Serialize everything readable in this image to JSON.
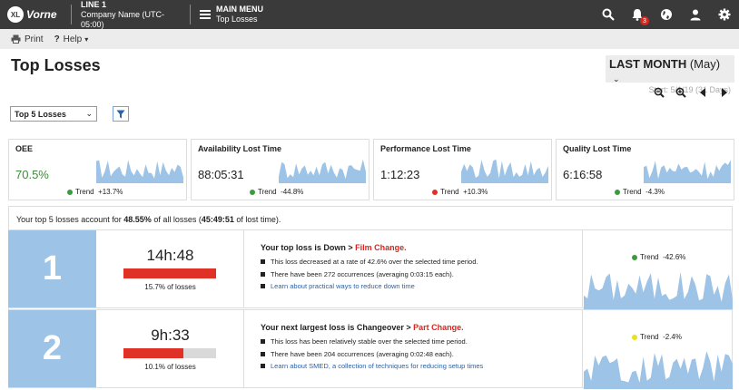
{
  "topbar": {
    "logo_text": "Vorne",
    "logo_mark": "XL",
    "line_title": "LINE 1",
    "company": "Company Name (UTC-05:00)",
    "menu_title": "MAIN MENU",
    "menu_sub": "Top Losses",
    "notification_count": "3",
    "icons": [
      "search-icon",
      "bell-icon",
      "globe-icon",
      "user-icon",
      "gear-icon"
    ]
  },
  "subbar": {
    "print_label": "Print",
    "help_label": "Help"
  },
  "page_title": "Top Losses",
  "period": {
    "label": "LAST MONTH",
    "month": "(May)",
    "start": "Start: 5/1/19 (31 Days)"
  },
  "selector": {
    "value": "Top 5 Losses"
  },
  "kpis": [
    {
      "title": "OEE",
      "value": "70.5%",
      "trend_label": "Trend",
      "trend": "+13.7%",
      "trend_color": "#3e9a3e"
    },
    {
      "title": "Availability Lost Time",
      "value": "88:05:31",
      "trend_label": "Trend",
      "trend": "-44.8%",
      "trend_color": "#3e9a3e"
    },
    {
      "title": "Performance Lost Time",
      "value": "1:12:23",
      "trend_label": "Trend",
      "trend": "+10.3%",
      "trend_color": "#e03127"
    },
    {
      "title": "Quality Lost Time",
      "value": "6:16:58",
      "trend_label": "Trend",
      "trend": "-4.3%",
      "trend_color": "#3e9a3e"
    }
  ],
  "summary": {
    "prefix": "Your top 5 losses account for",
    "percent": "48.55%",
    "middle": "of all losses (",
    "time": "45:49:51",
    "suffix": "of lost time)."
  },
  "losses": [
    {
      "rank": "1",
      "time": "14h:48",
      "fraction": 0.157,
      "pct_label": "15.7% of losses",
      "heading": "Your top loss is Down >",
      "heading_red": "Film Change.",
      "b1": "This loss decreased at a rate of 42.6% over the selected time period.",
      "b2": "There have been 272 occurrences (averaging 0:03:15 each).",
      "b3": "Learn about practical ways to reduce down time",
      "trend_label": "Trend",
      "trend": "-42.6%",
      "trend_color": "#3e9a3e"
    },
    {
      "rank": "2",
      "time": "9h:33",
      "fraction": 0.101,
      "pct_label": "10.1% of losses",
      "heading": "Your next largest loss is Changeover >",
      "heading_red": "Part Change.",
      "b1": "This loss has been relatively stable over the selected time period.",
      "b2": "There have been 204 occurrences (averaging 0:02:48 each).",
      "b3": "Learn about SMED, a collection of techniques for reducing setup times",
      "trend_label": "Trend",
      "trend": "-2.4%",
      "trend_color": "#e8e21a"
    }
  ]
}
